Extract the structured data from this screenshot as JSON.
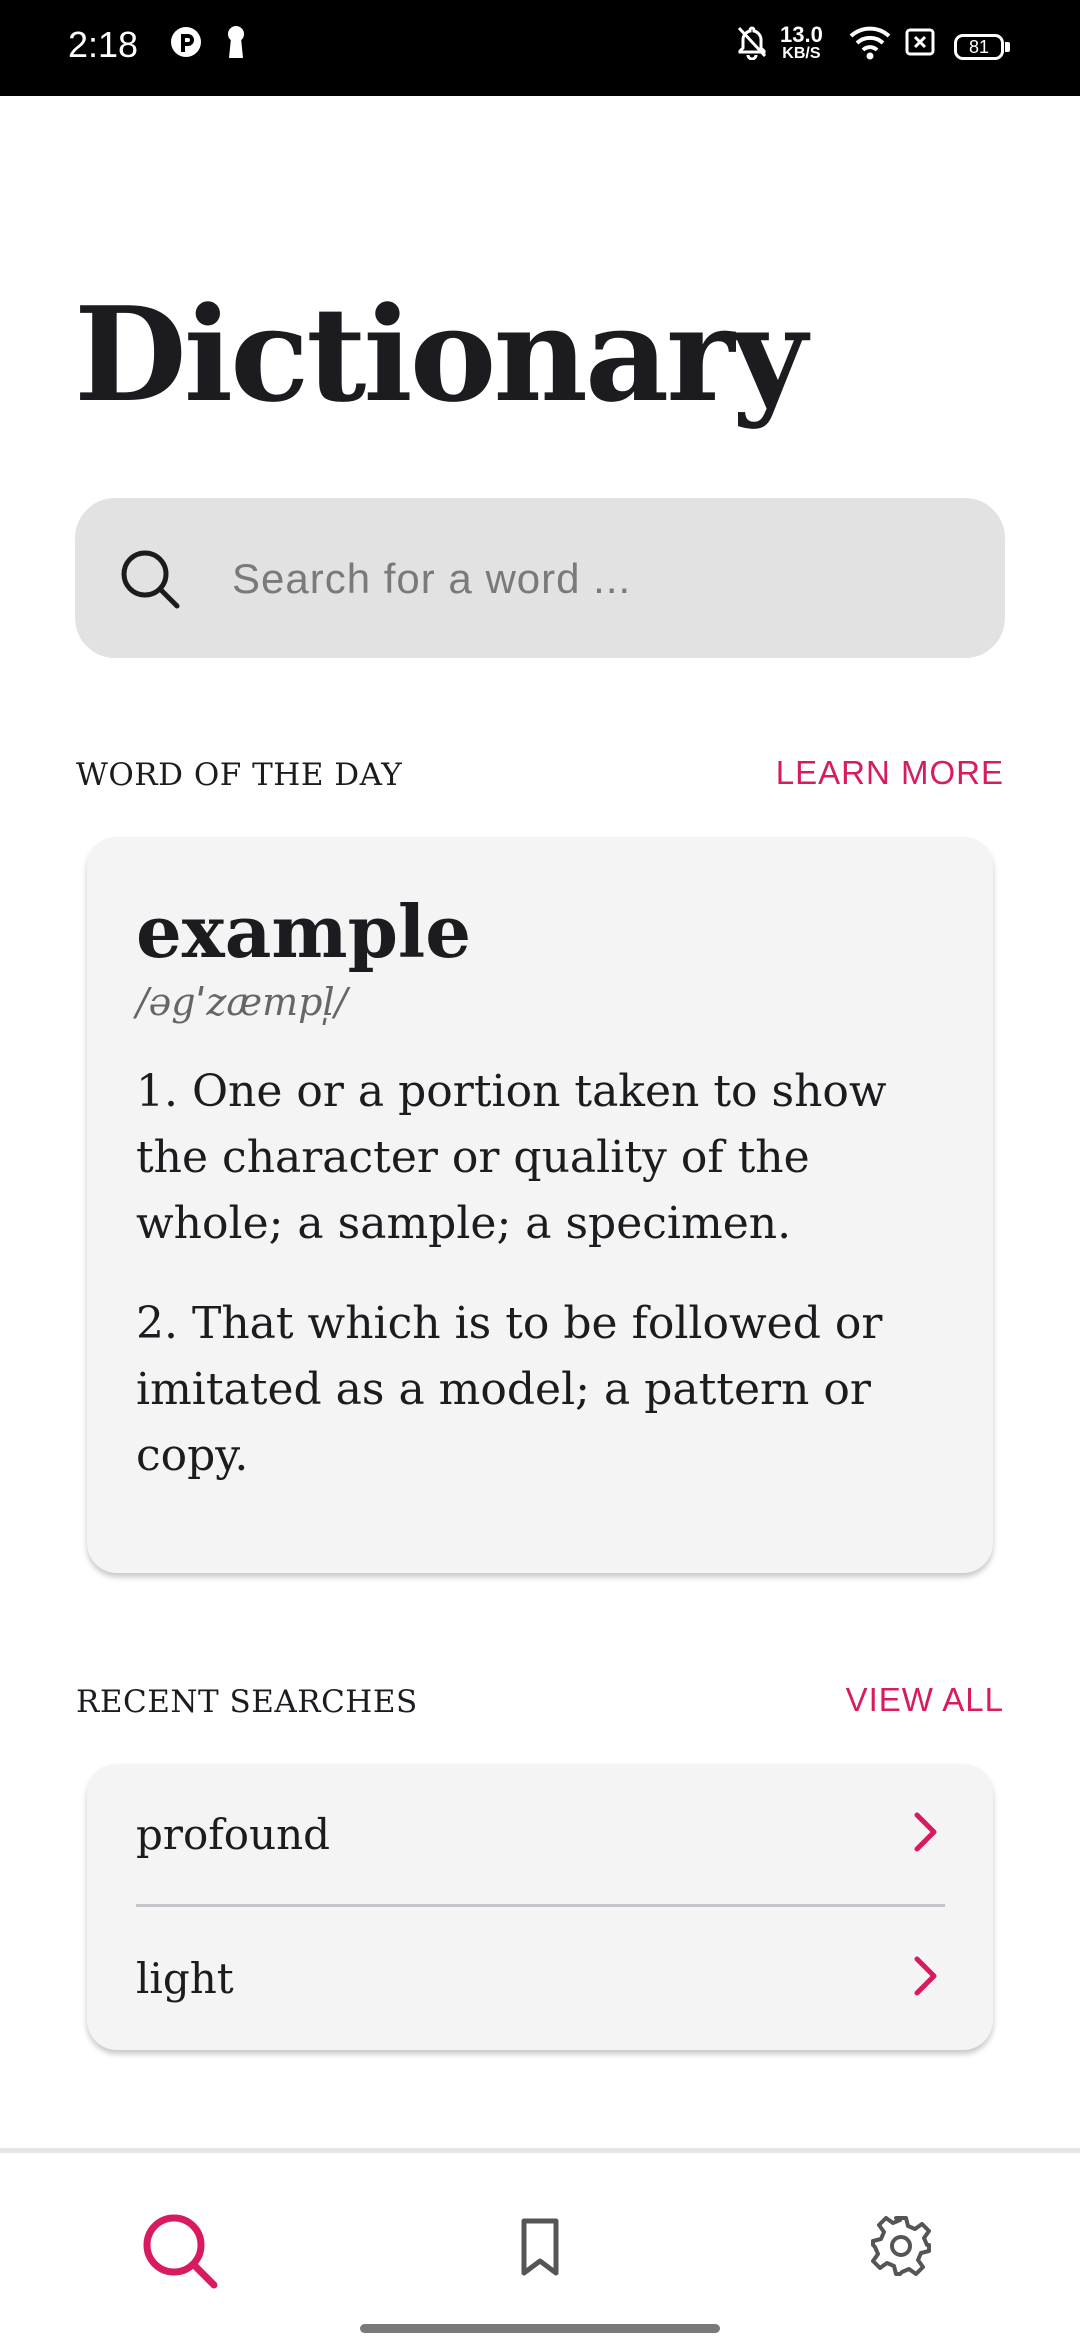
{
  "status_bar": {
    "time": "2:18",
    "speed_value": "13.0",
    "speed_unit": "KB/S",
    "battery": "81"
  },
  "header": {
    "title": "Dictionary"
  },
  "search": {
    "placeholder": "Search for a word ..."
  },
  "word_of_the_day": {
    "section_title": "WORD OF THE DAY",
    "link_label": "LEARN MORE",
    "word": "example",
    "phonetic": "/əgˈzæmpl̩/",
    "definitions": [
      "1. One or a portion taken to show the character or quality of the whole; a sample; a specimen.",
      "2. That which is to be followed or imitated as a model; a pattern or copy."
    ]
  },
  "recent_searches": {
    "section_title": "RECENT SEARCHES",
    "link_label": "VIEW ALL",
    "items": [
      {
        "label": "profound"
      },
      {
        "label": "light"
      }
    ]
  },
  "bottom_nav": {
    "items": [
      {
        "icon": "search-icon",
        "active": true
      },
      {
        "icon": "bookmark-icon",
        "active": false
      },
      {
        "icon": "gear-icon",
        "active": false
      }
    ]
  },
  "colors": {
    "accent": "#d81b60",
    "search_bg": "#e2e2e2",
    "card_bg": "#f4f4f4",
    "text": "#1c1b1f"
  }
}
